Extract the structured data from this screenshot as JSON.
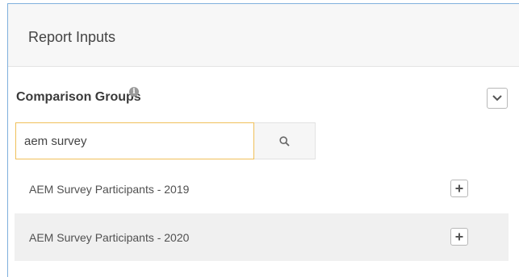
{
  "panel": {
    "title": "Report Inputs"
  },
  "comparison_groups": {
    "title": "Comparison Groups",
    "info_icon": "info-circle-icon",
    "collapse_icon": "chevron-down-icon"
  },
  "search": {
    "value": "aem survey",
    "icon": "search-icon"
  },
  "results": [
    {
      "label": "AEM Survey Participants - 2019",
      "action_icon": "plus-icon"
    },
    {
      "label": "AEM Survey Participants - 2020",
      "action_icon": "plus-icon"
    }
  ],
  "colors": {
    "panel_border": "#7fb0dd",
    "input_focus_border": "#f0c05a",
    "alt_row_bg": "#f0f0f0"
  }
}
